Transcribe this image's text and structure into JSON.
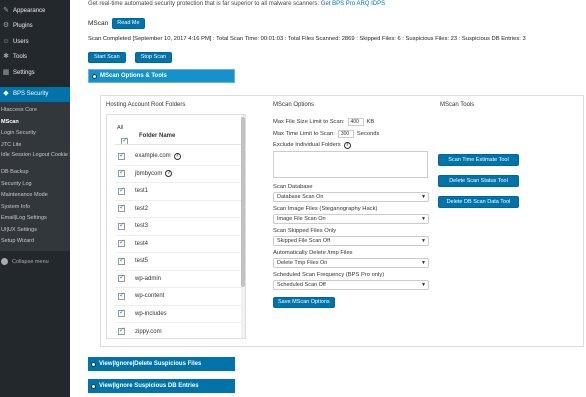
{
  "sidebar": {
    "items": [
      {
        "label": "Appearance",
        "icon": "paintbrush-icon"
      },
      {
        "label": "Plugins",
        "icon": "plugin-icon"
      },
      {
        "label": "Users",
        "icon": "users-icon"
      },
      {
        "label": "Tools",
        "icon": "wrench-icon"
      },
      {
        "label": "Settings",
        "icon": "settings-icon"
      }
    ],
    "active": {
      "label": "BPS Security",
      "icon": "shield-icon"
    },
    "submenu": [
      "Htaccess Core",
      "MScan",
      "Login Security",
      "JTC Lite",
      "Idle Session Logout Cookie Expiration",
      "DB Backup",
      "Security Log",
      "Maintenance Mode",
      "System Info",
      "Email|Log Settings",
      "UI|UX Settings",
      "Setup Wizard"
    ],
    "collapse_label": "Collapse menu"
  },
  "promo": {
    "text": "Get real-time automated security protection that is far superior to all malware scanners: ",
    "link": "Get BPS Pro ARQ IDPS"
  },
  "mscan": {
    "title": "MScan",
    "read_me": "Read Me",
    "status": "Scan Completed [September 10, 2017 4:16 PM] : Total Scan Time: 00:01:03 : Total Files Scanned: 2869 : Skipped Files: 6 : Suspicious Files: 23 : Suspicious DB Entries: 3",
    "start_scan": "Start Scan",
    "stop_scan": "Stop Scan"
  },
  "accordions": {
    "options": "MScan Options & Tools",
    "delete_files": "View|Ignore|Delete Suspicious Files",
    "delete_db": "View|Ignore Suspicious DB Entries"
  },
  "panel": {
    "hosting_header": "Hosting Account Root Folders",
    "options_header": "MScan Options",
    "tools_header": "MScan Tools",
    "all_label": "All",
    "folder_name_header": "Folder Name",
    "folders": [
      "example.com",
      "jbmbycom",
      "test1",
      "test2",
      "test3",
      "test4",
      "test5",
      "wp-admin",
      "wp-content",
      "wp-includes",
      "zippy.com"
    ],
    "max_file_size_label": "Max File Size Limit to Scan:",
    "max_file_size_value": "400",
    "max_file_size_unit": "KB",
    "max_time_label": "Max Time Limit to Scan:",
    "max_time_value": "300",
    "max_time_unit": "Seconds",
    "exclude_label": "Exclude Individual Folders",
    "scan_database_label": "Scan Database",
    "scan_database_value": "Database Scan On",
    "scan_image_label": "Scan Image Files (Steganography Hack)",
    "scan_image_value": "Image File Scan On",
    "scan_skipped_label": "Scan Skipped Files Only",
    "scan_skipped_value": "Skipped File Scan Off",
    "auto_delete_label": "Automatically Delete /tmp Files",
    "auto_delete_value": "Delete Tmp Files On",
    "scheduled_label": "Scheduled Scan Frequency (BPS Pro only)",
    "scheduled_value": "Scheduled Scan Off",
    "save_button": "Save MScan Options",
    "tools": [
      "Scan Time Estimate Tool",
      "Delete Scan Status Tool",
      "Delete DB Scan Data Tool"
    ]
  },
  "colors": {
    "accent": "#0073aa",
    "sidebar": "#23282d"
  }
}
